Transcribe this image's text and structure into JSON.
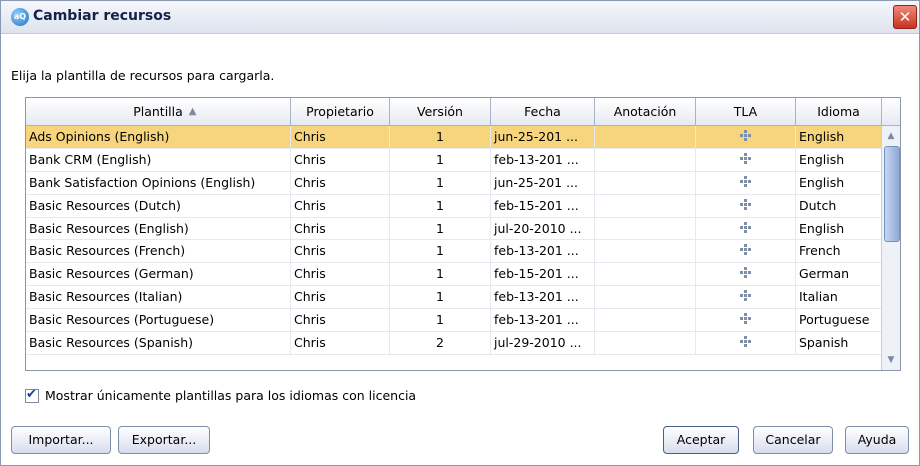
{
  "window": {
    "title": "Cambiar recursos",
    "close_glyph": "✕",
    "icon": "app-icon"
  },
  "prompt": "Elija la plantilla de recursos para cargarla.",
  "table": {
    "columns": [
      "Plantilla",
      "Propietario",
      "Versión",
      "Fecha",
      "Anotación",
      "TLA",
      "Idioma"
    ],
    "sort_glyph": "▲",
    "rows": [
      {
        "plantilla": "Ads Opinions (English)",
        "propietario": "Chris",
        "version": "1",
        "fecha": "jun-25-201 ...",
        "anotacion": "",
        "idioma": "English",
        "selected": true
      },
      {
        "plantilla": "Bank CRM (English)",
        "propietario": "Chris",
        "version": "1",
        "fecha": "feb-13-201 ...",
        "anotacion": "",
        "idioma": "English"
      },
      {
        "plantilla": "Bank Satisfaction Opinions (English)",
        "propietario": "Chris",
        "version": "1",
        "fecha": "jun-25-201 ...",
        "anotacion": "",
        "idioma": "English"
      },
      {
        "plantilla": "Basic Resources (Dutch)",
        "propietario": "Chris",
        "version": "1",
        "fecha": "feb-15-201 ...",
        "anotacion": "",
        "idioma": "Dutch"
      },
      {
        "plantilla": "Basic Resources (English)",
        "propietario": "Chris",
        "version": "1",
        "fecha": "jul-20-2010 ...",
        "anotacion": "",
        "idioma": "English"
      },
      {
        "plantilla": "Basic Resources (French)",
        "propietario": "Chris",
        "version": "1",
        "fecha": "feb-13-201 ...",
        "anotacion": "",
        "idioma": "French"
      },
      {
        "plantilla": "Basic Resources (German)",
        "propietario": "Chris",
        "version": "1",
        "fecha": "feb-15-201 ...",
        "anotacion": "",
        "idioma": "German"
      },
      {
        "plantilla": "Basic Resources (Italian)",
        "propietario": "Chris",
        "version": "1",
        "fecha": "feb-13-201 ...",
        "anotacion": "",
        "idioma": "Italian"
      },
      {
        "plantilla": "Basic Resources (Portuguese)",
        "propietario": "Chris",
        "version": "1",
        "fecha": "feb-13-201 ...",
        "anotacion": "",
        "idioma": "Portuguese"
      },
      {
        "plantilla": "Basic Resources (Spanish)",
        "propietario": "Chris",
        "version": "2",
        "fecha": "jul-29-2010 ...",
        "anotacion": "",
        "idioma": "Spanish"
      }
    ]
  },
  "checkbox": {
    "label": "Mostrar únicamente plantillas para los idiomas con licencia",
    "checked": true
  },
  "buttons": {
    "importar": "Importar...",
    "exportar": "Exportar...",
    "aceptar": "Aceptar",
    "cancelar": "Cancelar",
    "ayuda": "Ayuda"
  },
  "colors": {
    "selected_row": "#f6d57c",
    "close_button": "#c8331f"
  }
}
